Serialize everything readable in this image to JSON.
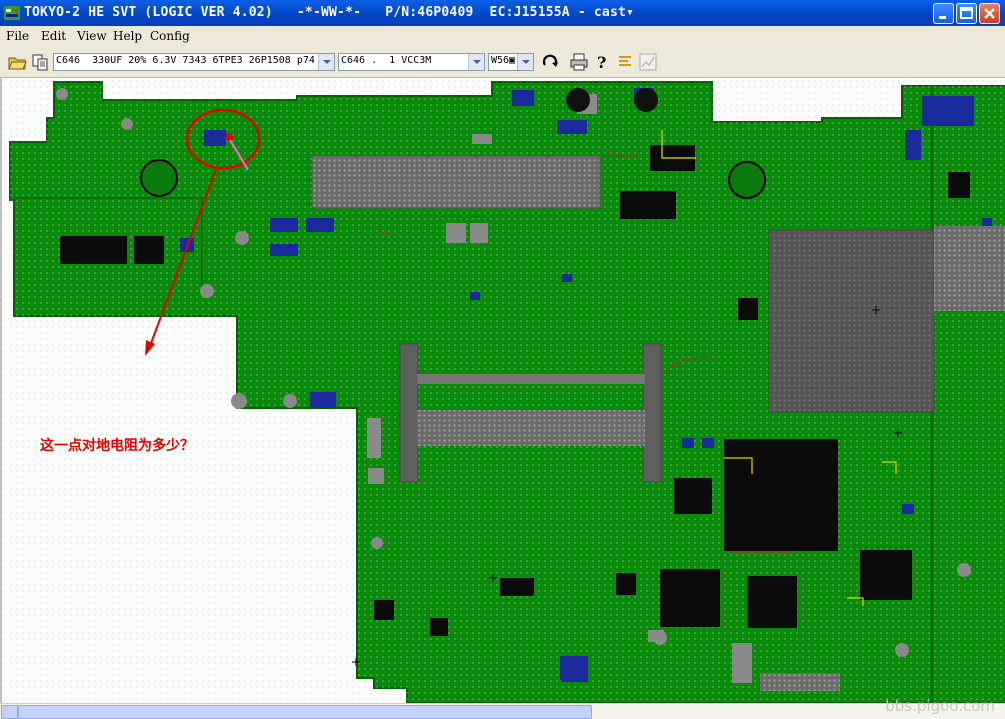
{
  "window": {
    "title": "TOKYO-2 HE SVT (LOGIC VER 4.02)   -*-WW-*-   P/N:46P0409  EC:J15155A - cast▾"
  },
  "menu": {
    "items": [
      "File",
      "Edit",
      "View",
      "Help",
      "Config"
    ]
  },
  "toolbar": {
    "component_select": "C646  330UF 20% 6.3V 7343 6TPE3 26P1508 p74",
    "net_select": "C646 .  1 VCC3M",
    "zoom_select": "W56▣"
  },
  "board": {
    "annotation_text": "这一点对地电阻为多少？",
    "colors": {
      "pcb": "#0a8a0a",
      "pcb_dark": "#067006",
      "annotation": "#e60000",
      "pad_blue": "#1a2a9a",
      "chip": "#111111",
      "silk_gray": "#8a8a8a"
    }
  },
  "watermark": "bbs.pigoo.com"
}
